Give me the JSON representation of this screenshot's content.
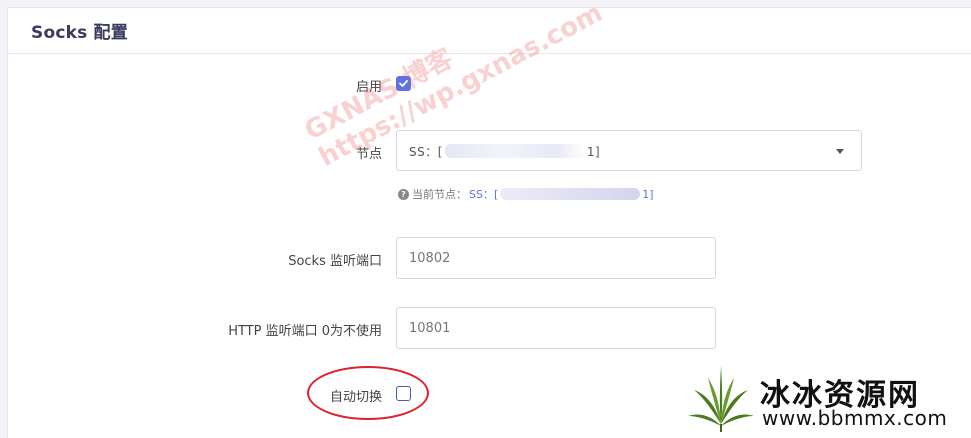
{
  "card": {
    "title": "Socks 配置"
  },
  "fields": {
    "enable": {
      "label": "启用",
      "checked": true
    },
    "node": {
      "label": "节点",
      "selected_prefix": "SS：[",
      "selected_suffix": "1]",
      "help_prefix": "当前节点：",
      "help_value_prefix": "SS：[",
      "help_value_suffix": "1]"
    },
    "socks_port": {
      "label": "Socks 监听端口",
      "value": "10802"
    },
    "http_port": {
      "label": "HTTP 监听端口 0为不使用",
      "value": "10801"
    },
    "auto_switch": {
      "label": "自动切换",
      "checked": false
    }
  },
  "watermark": {
    "line1": "GXNAS 博客",
    "line2": "https://wp.gxnas.com"
  },
  "site_logo": {
    "name": "冰冰资源网",
    "url": "www.bbmmx.com"
  },
  "colors": {
    "accent": "#5e72e4",
    "highlight": "#e0202a"
  }
}
